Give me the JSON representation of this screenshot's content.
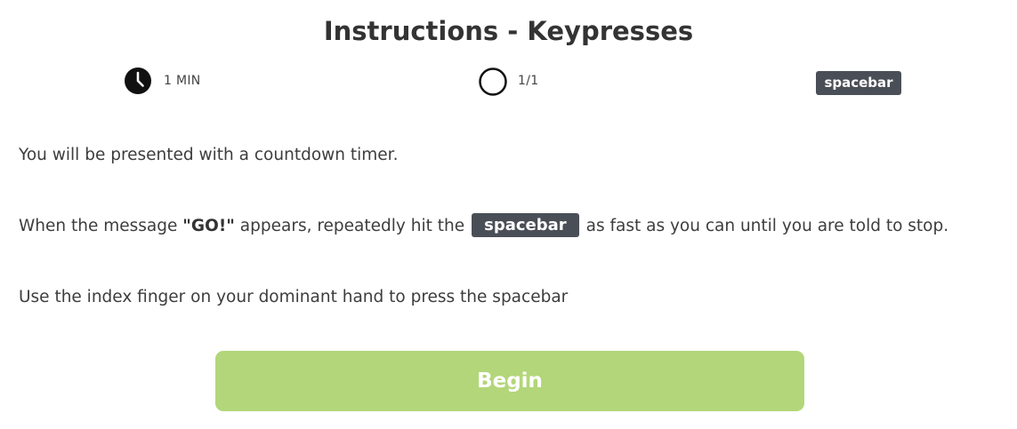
{
  "header": {
    "title": "Instructions - Keypresses"
  },
  "meta": {
    "timer": {
      "icon": "clock-icon",
      "label": "1 MIN"
    },
    "progress": {
      "icon": "circle-icon",
      "label": "1/1"
    },
    "key": {
      "label": "spacebar"
    }
  },
  "instructions": {
    "p1": "You will be presented with a countdown timer.",
    "p2_before": "When the message ",
    "p2_bold": "\"GO!\"",
    "p2_middle": " appears, repeatedly hit the",
    "p2_key": "spacebar",
    "p2_after": "as fast as you can until you are told to stop.",
    "p3": "Use the index finger on your dominant hand to press the spacebar"
  },
  "actions": {
    "begin_label": "Begin"
  },
  "colors": {
    "key_badge": "#4a4f57",
    "begin_button": "#b3d67a",
    "text": "#3d3d3d"
  }
}
